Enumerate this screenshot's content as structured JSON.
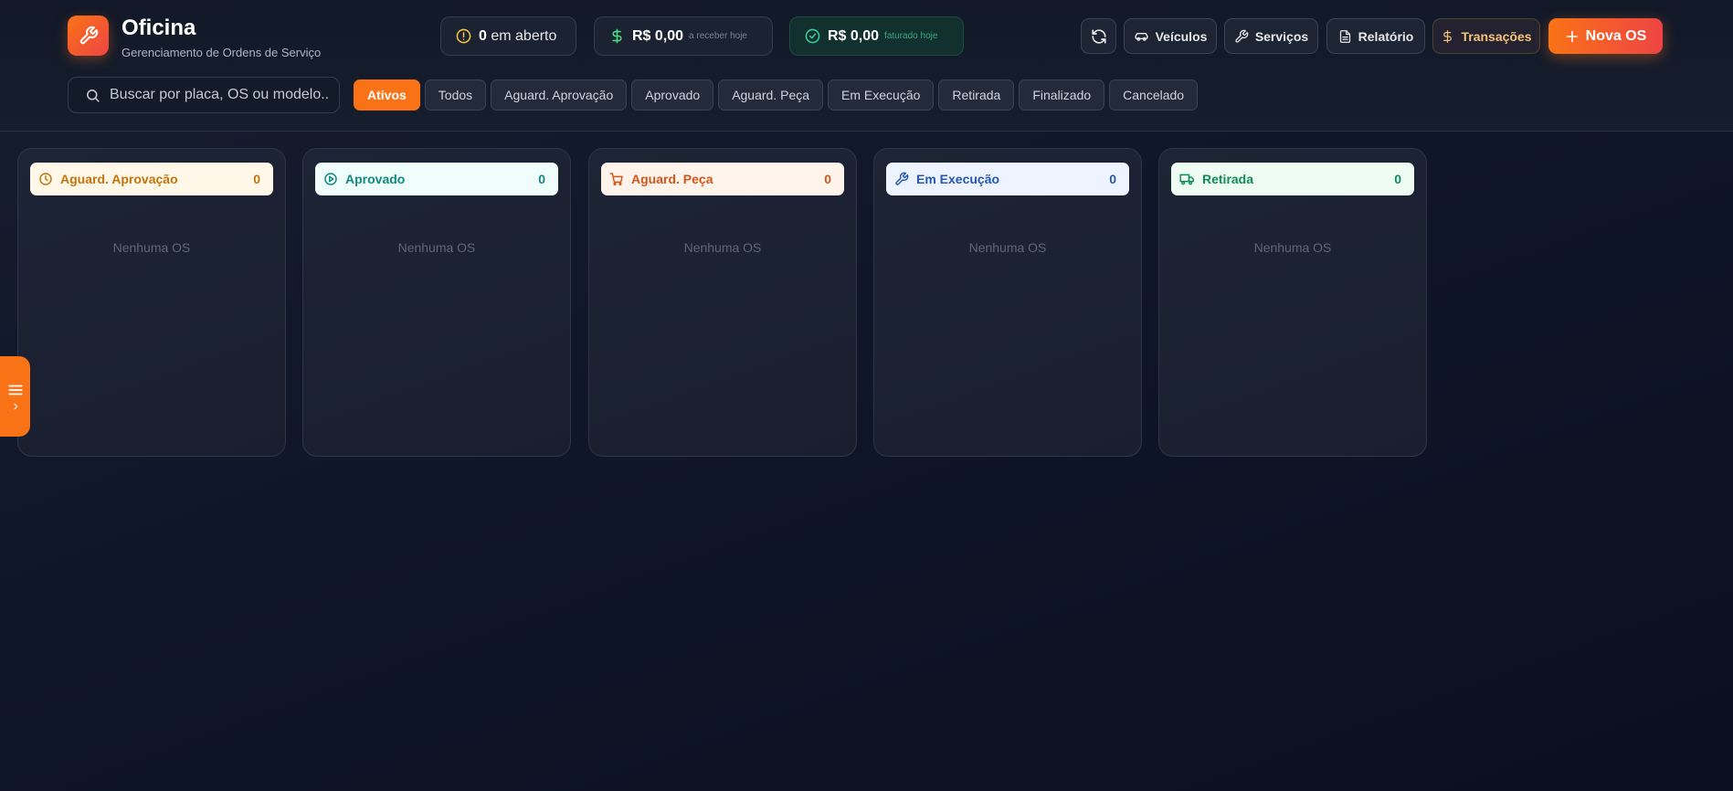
{
  "app": {
    "title": "Oficina",
    "subtitle": "Gerenciamento de Ordens de Serviço",
    "logo_icon": "wrench-icon"
  },
  "stats": [
    {
      "value": "0",
      "label": "em aberto",
      "icon": "alert-circle-icon",
      "color": "#f5c542"
    },
    {
      "value": "R$ 0,00",
      "label": "a receber hoje",
      "icon": "dollar-icon",
      "color": "#4ade80"
    },
    {
      "value": "R$ 0,00",
      "label": "faturado hoje",
      "icon": "check-circle-icon",
      "color": "#34d399"
    }
  ],
  "toolbar": {
    "refresh_icon": "refresh-icon",
    "vehicles_label": "Veículos",
    "services_label": "Serviços",
    "report_label": "Relatório",
    "transactions_label": "Transações",
    "new_os_label": "Nova OS"
  },
  "search": {
    "placeholder": "Buscar por placa, OS ou modelo...",
    "value": ""
  },
  "filters": [
    "Ativos",
    "Todos",
    "Aguard. Aprovação",
    "Aprovado",
    "Aguard. Peça",
    "Em Execução",
    "Retirada",
    "Finalizado",
    "Cancelado"
  ],
  "active_filter": "Ativos",
  "columns": [
    {
      "title": "Aguard. Aprovação",
      "count": "0",
      "icon": "clock-icon",
      "text_color": "#c2740c",
      "bg_color": "#fff8e8",
      "empty": "Nenhuma OS"
    },
    {
      "title": "Aprovado",
      "count": "0",
      "icon": "play-circle-icon",
      "text_color": "#0f8a7e",
      "bg_color": "#effdfb",
      "empty": "Nenhuma OS"
    },
    {
      "title": "Aguard. Peça",
      "count": "0",
      "icon": "cart-icon",
      "text_color": "#d0561a",
      "bg_color": "#fff4ec",
      "empty": "Nenhuma OS"
    },
    {
      "title": "Em Execução",
      "count": "0",
      "icon": "wrench-icon",
      "text_color": "#2557b5",
      "bg_color": "#eef4ff",
      "empty": "Nenhuma OS"
    },
    {
      "title": "Retirada",
      "count": "0",
      "icon": "truck-icon",
      "text_color": "#0f8a5a",
      "bg_color": "#eefcf4",
      "empty": "Nenhuma OS"
    }
  ],
  "colors": {
    "accent": "#f97316",
    "accent_end": "#ef4444",
    "background": "#0f1526"
  }
}
